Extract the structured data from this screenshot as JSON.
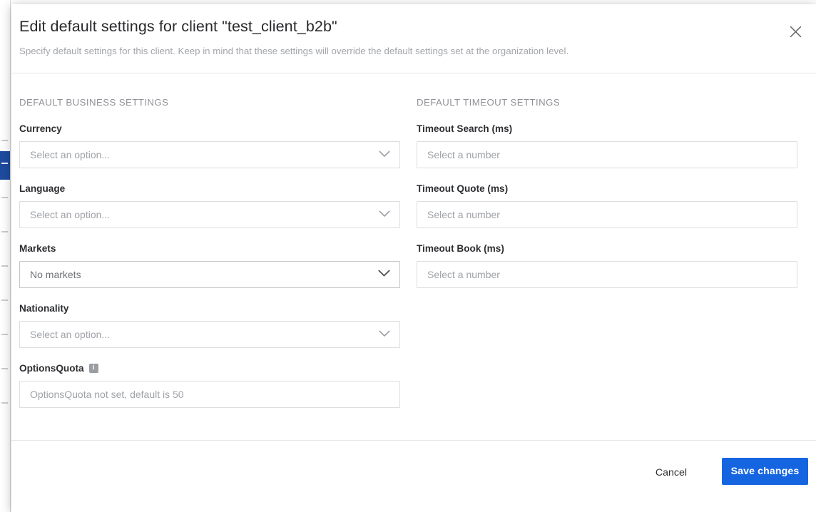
{
  "dialog": {
    "title": "Edit default settings for client \"test_client_b2b\"",
    "subtitle": "Specify default settings for this client. Keep in mind that these settings will override the default settings set at the organization level.",
    "close_icon": "close-icon"
  },
  "business": {
    "heading": "DEFAULT BUSINESS SETTINGS",
    "fields": [
      {
        "label": "Currency",
        "kind": "select",
        "value": "Select an option...",
        "chevron_icon": "chevron-down-icon"
      },
      {
        "label": "Language",
        "kind": "select",
        "value": "Select an option...",
        "chevron_icon": "chevron-down-icon"
      },
      {
        "label": "Markets",
        "kind": "select",
        "value": "No markets",
        "chevron_icon": "chevron-down-icon"
      },
      {
        "label": "Nationality",
        "kind": "select",
        "value": "Select an option...",
        "chevron_icon": "chevron-down-icon"
      },
      {
        "label": "OptionsQuota",
        "kind": "text",
        "placeholder": "OptionsQuota not set, default is 50",
        "info_icon": "info-icon",
        "info_glyph": "i"
      }
    ]
  },
  "timeout": {
    "heading": "DEFAULT TIMEOUT SETTINGS",
    "fields": [
      {
        "label": "Timeout Search (ms)",
        "kind": "text",
        "placeholder": "Select a number"
      },
      {
        "label": "Timeout Quote (ms)",
        "kind": "text",
        "placeholder": "Select a number"
      },
      {
        "label": "Timeout Book (ms)",
        "kind": "text",
        "placeholder": "Select a number"
      }
    ]
  },
  "footer": {
    "cancel_label": "Cancel",
    "save_label": "Save changes",
    "save_color": "#1665e0"
  }
}
